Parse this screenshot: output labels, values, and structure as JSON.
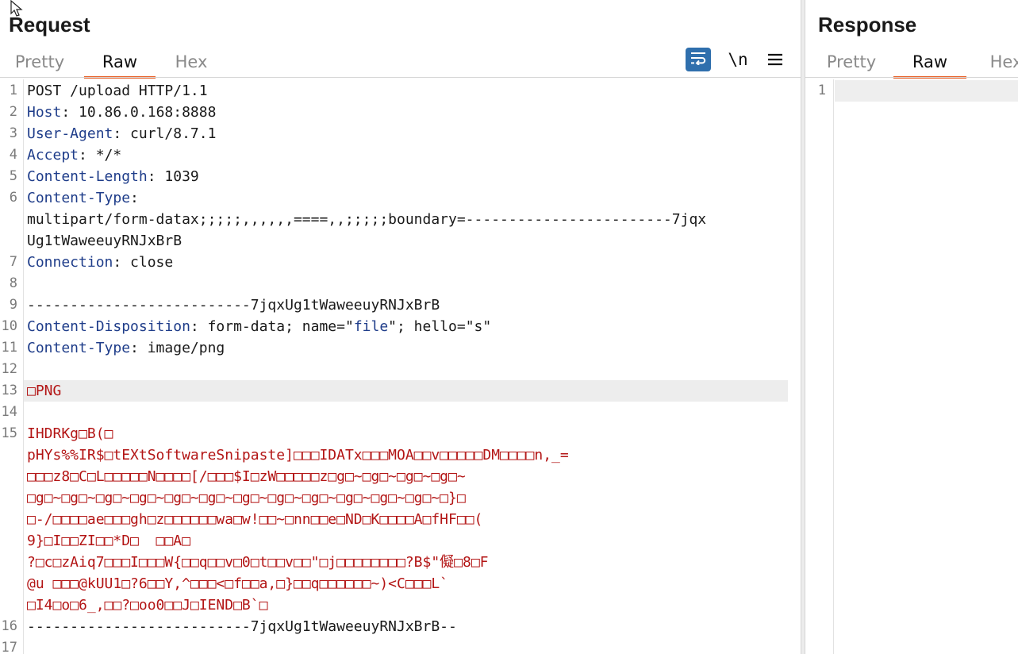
{
  "request": {
    "title": "Request",
    "tabs": [
      "Pretty",
      "Raw",
      "Hex"
    ],
    "active_tab": "Raw",
    "toolbar": {
      "newline_label": "\\n"
    },
    "lines": [
      {
        "n": "1",
        "parts": [
          {
            "t": "POST /upload HTTP/1.1",
            "c": ""
          }
        ]
      },
      {
        "n": "2",
        "parts": [
          {
            "t": "Host",
            "c": "key"
          },
          {
            "t": ": 10.86.0.168:8888",
            "c": ""
          }
        ]
      },
      {
        "n": "3",
        "parts": [
          {
            "t": "User-Agent",
            "c": "key"
          },
          {
            "t": ": curl/8.7.1",
            "c": ""
          }
        ]
      },
      {
        "n": "4",
        "parts": [
          {
            "t": "Accept",
            "c": "key"
          },
          {
            "t": ": */*",
            "c": ""
          }
        ]
      },
      {
        "n": "5",
        "parts": [
          {
            "t": "Content-Length",
            "c": "key"
          },
          {
            "t": ": 1039",
            "c": ""
          }
        ]
      },
      {
        "n": "6",
        "parts": [
          {
            "t": "Content-Type",
            "c": "key"
          },
          {
            "t": ":",
            "c": ""
          }
        ]
      },
      {
        "n": "",
        "parts": [
          {
            "t": "multipart/form-datax;;;;;,,,,,,====,,;;;;;boundary=------------------------7jqx",
            "c": ""
          }
        ]
      },
      {
        "n": "",
        "parts": [
          {
            "t": "Ug1tWaweeuyRNJxBrB",
            "c": ""
          }
        ]
      },
      {
        "n": "7",
        "parts": [
          {
            "t": "Connection",
            "c": "key"
          },
          {
            "t": ": close",
            "c": ""
          }
        ]
      },
      {
        "n": "8",
        "parts": []
      },
      {
        "n": "9",
        "parts": [
          {
            "t": "--------------------------7jqxUg1tWaweeuyRNJxBrB",
            "c": ""
          }
        ]
      },
      {
        "n": "10",
        "parts": [
          {
            "t": "Content-Disposition",
            "c": "key"
          },
          {
            "t": ": form-data; name=\"",
            "c": ""
          },
          {
            "t": "file",
            "c": "blue"
          },
          {
            "t": "\"; hello=\"s\"",
            "c": ""
          }
        ]
      },
      {
        "n": "11",
        "parts": [
          {
            "t": "Content-Type",
            "c": "key"
          },
          {
            "t": ": image/png",
            "c": ""
          }
        ]
      },
      {
        "n": "12",
        "parts": []
      },
      {
        "n": "13",
        "highlight": true,
        "parts": [
          {
            "t": "□PNG",
            "c": "red"
          }
        ]
      },
      {
        "n": "14",
        "parts": []
      },
      {
        "n": "15",
        "parts": [
          {
            "t": "IHDRKg□B(□",
            "c": "red"
          }
        ]
      },
      {
        "n": "",
        "parts": [
          {
            "t": "pHYs%%IR$□tEXtSoftwareSnipaste]□□□IDATx□□□MOA□□v□□□□□DM□□□□n,_=",
            "c": "red"
          }
        ]
      },
      {
        "n": "",
        "parts": [
          {
            "t": "□□□z8□C□L□□□□□N□□□□[/□□□$I□zW□□□□□z□g□~□g□~□g□~□g□~",
            "c": "red"
          }
        ]
      },
      {
        "n": "",
        "parts": [
          {
            "t": "□g□~□g□~□g□~□g□~□g□~□g□~□g□~□g□~□g□~□g□~□g□~□g□~□}□",
            "c": "red"
          }
        ]
      },
      {
        "n": "",
        "parts": [
          {
            "t": "□-/□□□□ae□□□gh□z□□□□□□wa□w!□□~□nn□□e□ND□K□□□□A□fHF□□(",
            "c": "red"
          }
        ]
      },
      {
        "n": "",
        "parts": [
          {
            "t": "9}□I□□ZI□□*D□  □□A□",
            "c": "red"
          }
        ]
      },
      {
        "n": "",
        "parts": [
          {
            "t": "?□c□zAiq7□□□I□□□W{□□q□□v□0□t□□v□□\"□j□□□□□□□□?B$\"儗□8□F",
            "c": "red"
          }
        ]
      },
      {
        "n": "",
        "parts": [
          {
            "t": "@u □□□@kUU1□?6□□Y,^□□□<□f□□a,□}□□q□□□□□□~)<C□□□L`",
            "c": "red"
          }
        ]
      },
      {
        "n": "",
        "parts": [
          {
            "t": "□I4□o□6_,□□?□oo0□□J□IEND□B`□",
            "c": "red"
          }
        ]
      },
      {
        "n": "16",
        "parts": [
          {
            "t": "--------------------------7jqxUg1tWaweeuyRNJxBrB--",
            "c": ""
          }
        ]
      },
      {
        "n": "17",
        "parts": []
      }
    ]
  },
  "response": {
    "title": "Response",
    "tabs": [
      "Pretty",
      "Raw",
      "Hex"
    ],
    "active_tab": "Raw",
    "lines": [
      {
        "n": "1"
      }
    ]
  }
}
